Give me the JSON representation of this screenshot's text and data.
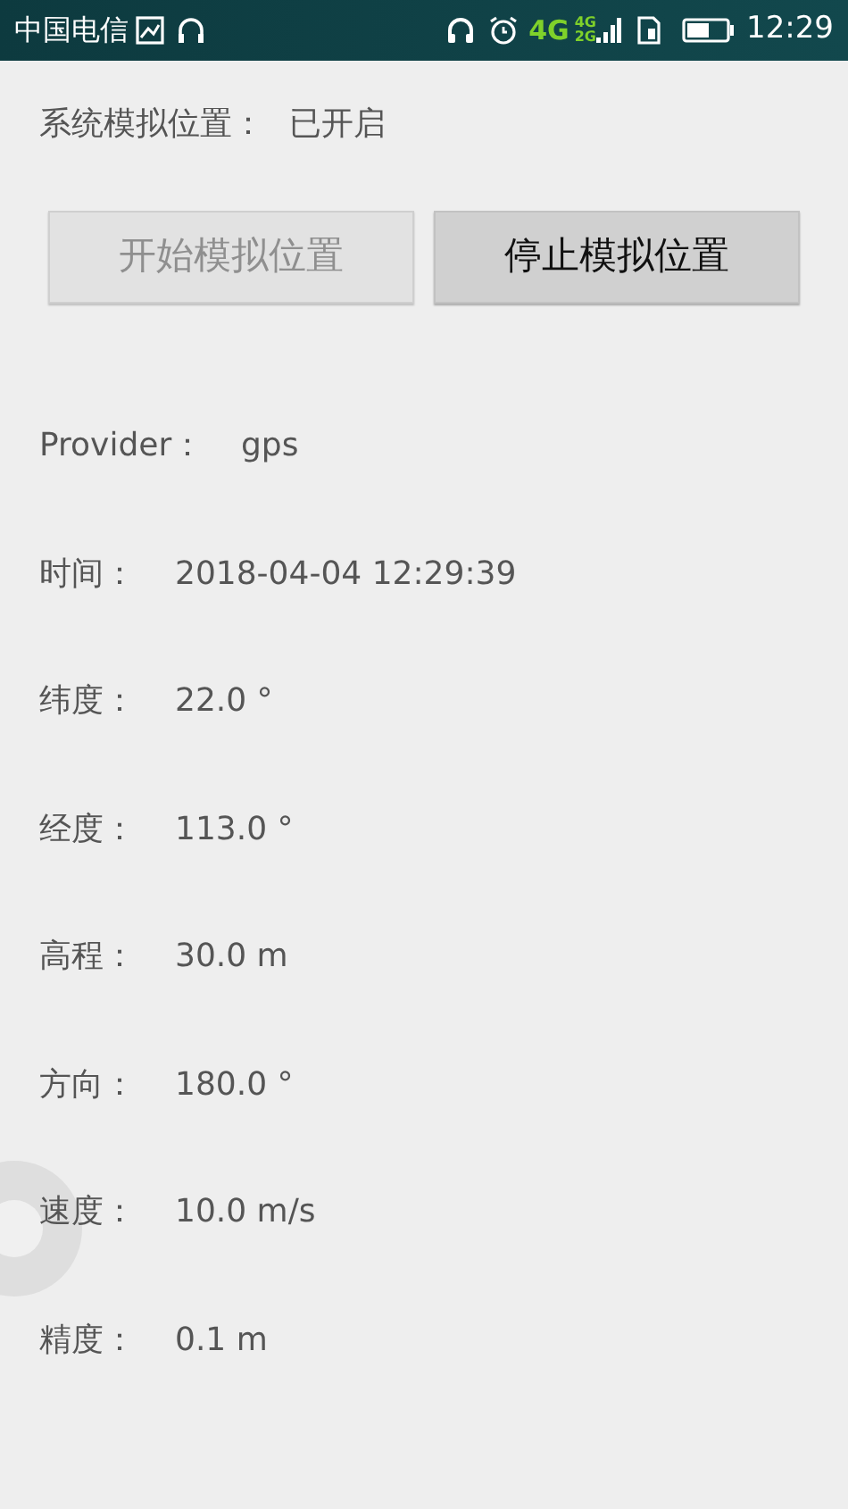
{
  "status_bar": {
    "carrier": "中国电信",
    "network_1": "4G",
    "network_2_top": "4G",
    "network_2_bottom": "2G",
    "time": "12:29"
  },
  "mock_status": {
    "label": "系统模拟位置：",
    "value": "已开启"
  },
  "buttons": [
    {
      "label": "开始模拟位置",
      "disabled": true
    },
    {
      "label": "停止模拟位置",
      "disabled": false
    }
  ],
  "fields": [
    {
      "label": "Provider：",
      "value": "gps"
    },
    {
      "label": "时间：",
      "value": "2018-04-04 12:29:39"
    },
    {
      "label": "纬度：",
      "value": "22.0 °"
    },
    {
      "label": "经度：",
      "value": "113.0 °"
    },
    {
      "label": "高程：",
      "value": "30.0 m"
    },
    {
      "label": "方向：",
      "value": "180.0 °"
    },
    {
      "label": "速度：",
      "value": "10.0 m/s"
    },
    {
      "label": "精度：",
      "value": "0.1 m"
    }
  ]
}
